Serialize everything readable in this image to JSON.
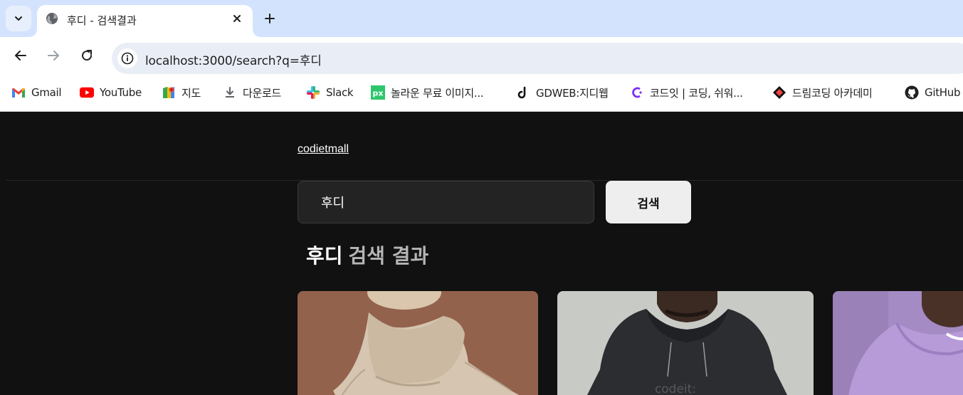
{
  "browser": {
    "tab_title": "후디 - 검색결과",
    "url": "localhost:3000/search?q=후디",
    "bookmarks": [
      {
        "label": "Gmail",
        "icon": "gmail-icon"
      },
      {
        "label": "YouTube",
        "icon": "youtube-icon"
      },
      {
        "label": "지도",
        "icon": "maps-icon"
      },
      {
        "label": "다운로드",
        "icon": "download-icon"
      },
      {
        "label": "Slack",
        "icon": "slack-icon"
      },
      {
        "label": "놀라운 무료 이미지...",
        "icon": "pixabay-icon"
      },
      {
        "label": "GDWEB:지디웹",
        "icon": "gdweb-icon"
      },
      {
        "label": "코드잇 | 코딩, 쉬워...",
        "icon": "codeit-icon"
      },
      {
        "label": "드림코딩 아카데미",
        "icon": "dreamcoding-icon"
      },
      {
        "label": "GitHub",
        "icon": "github-icon"
      }
    ]
  },
  "header": {
    "logo": "codietmall"
  },
  "search": {
    "value": "후디",
    "button_label": "검색"
  },
  "results": {
    "query": "후디",
    "heading_suffix": "검색 결과"
  },
  "colors": {
    "page_bg": "#111111",
    "input_bg": "#232323",
    "button_bg": "#eeeeee",
    "tabbar_bg": "#d3e3fd"
  }
}
